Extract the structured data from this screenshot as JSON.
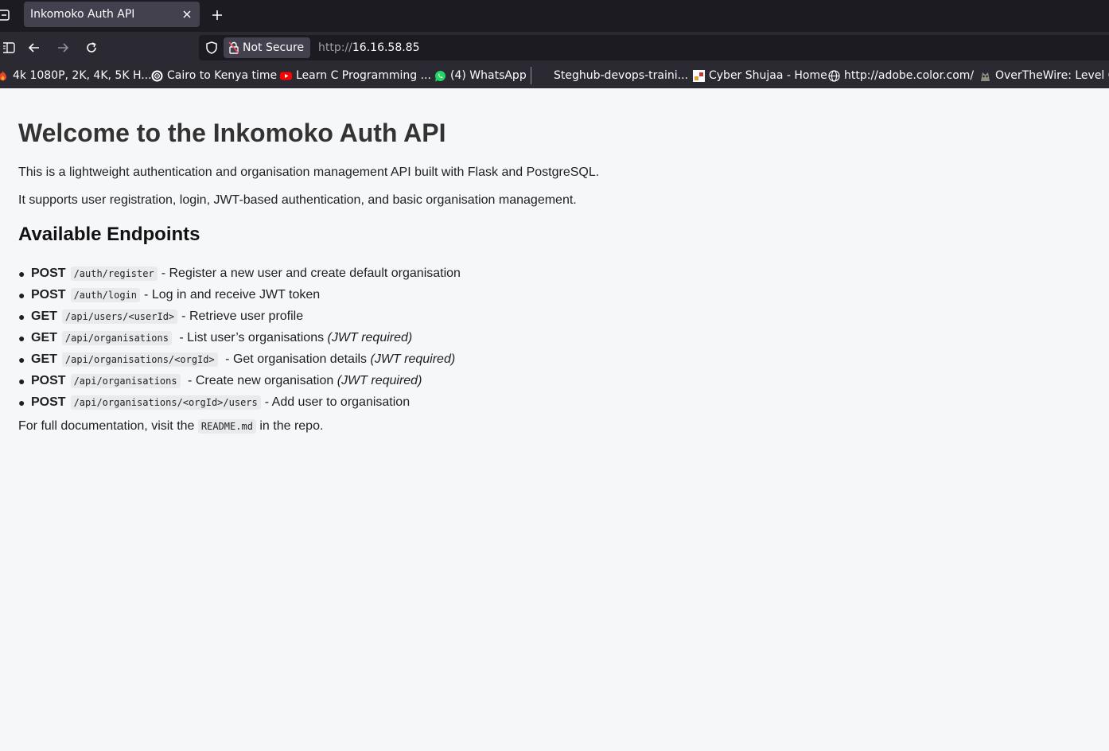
{
  "browser": {
    "tab": {
      "title": "Inkomoko Auth API"
    },
    "security": {
      "label": "Not Secure"
    },
    "url": {
      "scheme": "http://",
      "host": "16.16.58.85"
    },
    "bookmarks": [
      {
        "label": "4k 1080P, 2K, 4K, 5K H...",
        "icon": "flame-icon"
      },
      {
        "label": "Cairo to Kenya time",
        "icon": "chatgpt-icon"
      },
      {
        "label": "Learn C Programming ...",
        "icon": "youtube-icon"
      },
      {
        "label": "(4) WhatsApp",
        "icon": "whatsapp-icon"
      },
      {
        "label": "Steghub-devops-traini...",
        "icon": "github-icon"
      },
      {
        "label": "Cyber Shujaa - Home",
        "icon": "site-icon"
      },
      {
        "label": "http://adobe.color.com/",
        "icon": "globe-icon"
      },
      {
        "label": "OverTheWire: Level G",
        "icon": "overthewire-icon"
      }
    ]
  },
  "page": {
    "title": "Welcome to the Inkomoko Auth API",
    "intro1": "This is a lightweight authentication and organisation management API built with Flask and PostgreSQL.",
    "intro2": "It supports user registration, login, JWT-based authentication, and basic organisation management.",
    "endpoints_heading": "Available Endpoints",
    "endpoints": [
      {
        "method": "POST",
        "path": "/auth/register",
        "desc": " - Register a new user and create default organisation",
        "note": ""
      },
      {
        "method": "POST",
        "path": "/auth/login",
        "desc": " - Log in and receive JWT token",
        "note": ""
      },
      {
        "method": "GET",
        "path": "/api/users/<userId>",
        "desc": " - Retrieve user profile",
        "note": ""
      },
      {
        "method": "GET",
        "path": "/api/organisations",
        "desc": " - List user’s organisations ",
        "note": "(JWT required)"
      },
      {
        "method": "GET",
        "path": "/api/organisations/<orgId>",
        "desc": " - Get organisation details ",
        "note": "(JWT required)"
      },
      {
        "method": "POST",
        "path": "/api/organisations",
        "desc": " - Create new organisation ",
        "note": "(JWT required)"
      },
      {
        "method": "POST",
        "path": "/api/organisations/<orgId>/users",
        "desc": " - Add user to organisation",
        "note": ""
      }
    ],
    "footer": {
      "prefix": "For full documentation, visit the ",
      "file": "README.md",
      "suffix": " in the repo."
    }
  },
  "colors": {
    "chrome_dark": "#1c1b22",
    "toolbar": "#2b2a33",
    "tab_active": "#42414d",
    "page_bg": "#f6f7f9",
    "code_bg": "#e9eaec"
  }
}
